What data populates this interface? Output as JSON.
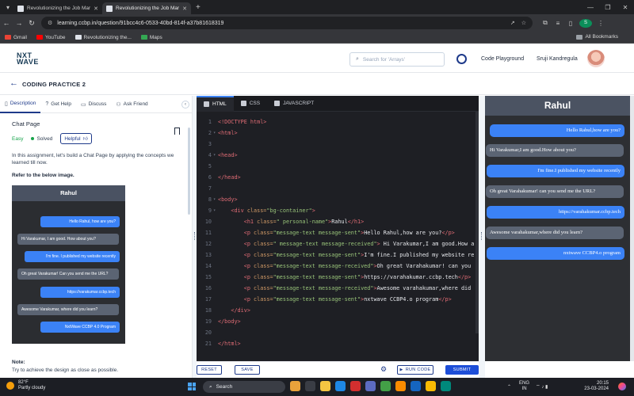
{
  "browser": {
    "tabs": [
      {
        "title": "Revolutionizing the Job Market",
        "active": false
      },
      {
        "title": "Revolutionizing the Job Market",
        "active": true
      }
    ],
    "url": "learning.ccbp.in/question/91bcc4c6-0533-40bd-814f-a37b81618319",
    "profile_initial": "S",
    "bookmarks": [
      "Gmail",
      "YouTube",
      "Revolutionizing the...",
      "Maps"
    ],
    "all_bookmarks": "All Bookmarks"
  },
  "header": {
    "logo_top": "NXT",
    "logo_bottom": "WAVE",
    "search_placeholder": "Search for 'Arrays'",
    "code_playground": "Code Playground",
    "user_name": "Sruji Kandregula"
  },
  "practice": {
    "title": "CODING PRACTICE 2"
  },
  "description": {
    "tabs": [
      "Description",
      "Get Help",
      "Discuss",
      "Ask Friend"
    ],
    "question_title": "Chat Page",
    "difficulty": "Easy",
    "status": "Solved",
    "helpful_label": "Helpful",
    "intro": "In this assignment, let's build a Chat Page by applying the concepts we learned till now.",
    "refer_label": "Refer to the below image.",
    "preview": {
      "title": "Rahul",
      "messages": [
        {
          "text": "Hello Rahul, how are you?",
          "type": "sent"
        },
        {
          "text": "Hi Varakumar, I am good. How about you?",
          "type": "recv"
        },
        {
          "text": "I'm fine. I published my website recently",
          "type": "sent"
        },
        {
          "text": "Oh great Varakumar! Can you send me the URL?",
          "type": "recv"
        },
        {
          "text": "https://varakumar.ccbp.tech",
          "type": "sent"
        },
        {
          "text": "Awesome Varakumar, where did you learn?",
          "type": "recv"
        },
        {
          "text": "NxtWave CCBP 4.0 Program",
          "type": "sent"
        }
      ]
    },
    "note_label": "Note:",
    "note_text": "Try to achieve the design as close as possible."
  },
  "editor": {
    "tabs": [
      "HTML",
      "CSS",
      "JAVASCRIPT"
    ],
    "active_tab": "HTML",
    "lines": [
      {
        "n": "1",
        "fold": "",
        "parts": [
          [
            "t",
            "<!DOCTYPE html>"
          ]
        ]
      },
      {
        "n": "2",
        "fold": "▾",
        "parts": [
          [
            "t",
            "<html>"
          ]
        ]
      },
      {
        "n": "3",
        "fold": "",
        "parts": []
      },
      {
        "n": "4",
        "fold": "▾",
        "parts": [
          [
            "t",
            "<head>"
          ]
        ]
      },
      {
        "n": "5",
        "fold": "",
        "parts": []
      },
      {
        "n": "6",
        "fold": "",
        "parts": [
          [
            "t",
            "</head>"
          ]
        ]
      },
      {
        "n": "7",
        "fold": "",
        "parts": []
      },
      {
        "n": "8",
        "fold": "▾",
        "parts": [
          [
            "t",
            "<body>"
          ]
        ]
      },
      {
        "n": "9",
        "fold": "▾",
        "parts": [
          [
            "x",
            "    "
          ],
          [
            "t",
            "<div "
          ],
          [
            "a",
            "class="
          ],
          [
            "s",
            "\"bg-container\""
          ],
          [
            "t",
            ">"
          ]
        ]
      },
      {
        "n": "10",
        "fold": "",
        "parts": [
          [
            "x",
            "        "
          ],
          [
            "t",
            "<h1 "
          ],
          [
            "a",
            "class="
          ],
          [
            "s",
            "\" personal-name\""
          ],
          [
            "t",
            ">"
          ],
          [
            "x",
            "Rahul"
          ],
          [
            "t",
            "</h1>"
          ]
        ]
      },
      {
        "n": "11",
        "fold": "",
        "parts": [
          [
            "x",
            "        "
          ],
          [
            "t",
            "<p "
          ],
          [
            "a",
            "class="
          ],
          [
            "s",
            "\"message-text message-sent\""
          ],
          [
            "t",
            ">"
          ],
          [
            "x",
            "Hello Rahul,how are you?"
          ],
          [
            "t",
            "</p>"
          ]
        ]
      },
      {
        "n": "12",
        "fold": "",
        "parts": [
          [
            "x",
            "        "
          ],
          [
            "t",
            "<p "
          ],
          [
            "a",
            "class="
          ],
          [
            "s",
            "\" message-text message-received\""
          ],
          [
            "t",
            ">"
          ],
          [
            "x",
            " Hi Varakumar,I am good.How a"
          ]
        ]
      },
      {
        "n": "13",
        "fold": "",
        "parts": [
          [
            "x",
            "        "
          ],
          [
            "t",
            "<p "
          ],
          [
            "a",
            "class="
          ],
          [
            "s",
            "\"message-text message-sent\""
          ],
          [
            "t",
            ">"
          ],
          [
            "x",
            "I'm fine.I published my website re"
          ]
        ]
      },
      {
        "n": "14",
        "fold": "",
        "parts": [
          [
            "x",
            "        "
          ],
          [
            "t",
            "<p "
          ],
          [
            "a",
            "class="
          ],
          [
            "s",
            "\"message-text message-received\""
          ],
          [
            "t",
            ">"
          ],
          [
            "x",
            "Oh great Varahakumar! can you"
          ]
        ]
      },
      {
        "n": "15",
        "fold": "",
        "parts": [
          [
            "x",
            "        "
          ],
          [
            "t",
            "<p "
          ],
          [
            "a",
            "class="
          ],
          [
            "s",
            "\"message-text message-sent\""
          ],
          [
            "t",
            ">"
          ],
          [
            "x",
            "https://varahakumar.ccbp.tech"
          ],
          [
            "t",
            "</p>"
          ]
        ]
      },
      {
        "n": "16",
        "fold": "",
        "parts": [
          [
            "x",
            "        "
          ],
          [
            "t",
            "<p "
          ],
          [
            "a",
            "class="
          ],
          [
            "s",
            "\"message-text message-received\""
          ],
          [
            "t",
            ">"
          ],
          [
            "x",
            "Awesome varahakumar,where did"
          ]
        ]
      },
      {
        "n": "17",
        "fold": "",
        "parts": [
          [
            "x",
            "        "
          ],
          [
            "t",
            "<p "
          ],
          [
            "a",
            "class="
          ],
          [
            "s",
            "\"message-text message-sent\""
          ],
          [
            "t",
            ">"
          ],
          [
            "x",
            "nxtwave CCBP4.o program"
          ],
          [
            "t",
            "</p>"
          ]
        ]
      },
      {
        "n": "18",
        "fold": "",
        "parts": [
          [
            "x",
            "    "
          ],
          [
            "t",
            "</div>"
          ]
        ]
      },
      {
        "n": "19",
        "fold": "",
        "parts": [
          [
            "t",
            "</body>"
          ]
        ]
      },
      {
        "n": "20",
        "fold": "",
        "parts": []
      },
      {
        "n": "21",
        "fold": "",
        "parts": [
          [
            "t",
            "</html>"
          ]
        ]
      }
    ],
    "reset_label": "RESET",
    "save_label": "SAVE",
    "run_label": "RUN CODE",
    "submit_label": "SUBMIT"
  },
  "output": {
    "title": "Rahul",
    "messages": [
      {
        "text": "Hello Rahul,how are you?",
        "type": "sent"
      },
      {
        "text": "Hi Varakumar,I am good.How about you?",
        "type": "recv"
      },
      {
        "text": "I'm fine.I published my website recently",
        "type": "sent"
      },
      {
        "text": "Oh great Varahakumar! can you send me the URL?",
        "type": "recv"
      },
      {
        "text": "https://varahakumar.ccbp.tech",
        "type": "sent"
      },
      {
        "text": "Awesome varahakumar,where did you learn?",
        "type": "recv"
      },
      {
        "text": "nxtwave CCBP4.o program",
        "type": "sent"
      }
    ]
  },
  "taskbar": {
    "temperature": "82°F",
    "weather": "Partly cloudy",
    "search": "Search",
    "lang_top": "ENG",
    "lang_bottom": "IN",
    "time": "20:15",
    "date": "23-03-2024"
  },
  "colors": {
    "accent": "#1e3a8a",
    "sent_bubble": "#3b82f6",
    "recv_bubble": "#5b6473",
    "editor_bg": "#1e1f24"
  }
}
